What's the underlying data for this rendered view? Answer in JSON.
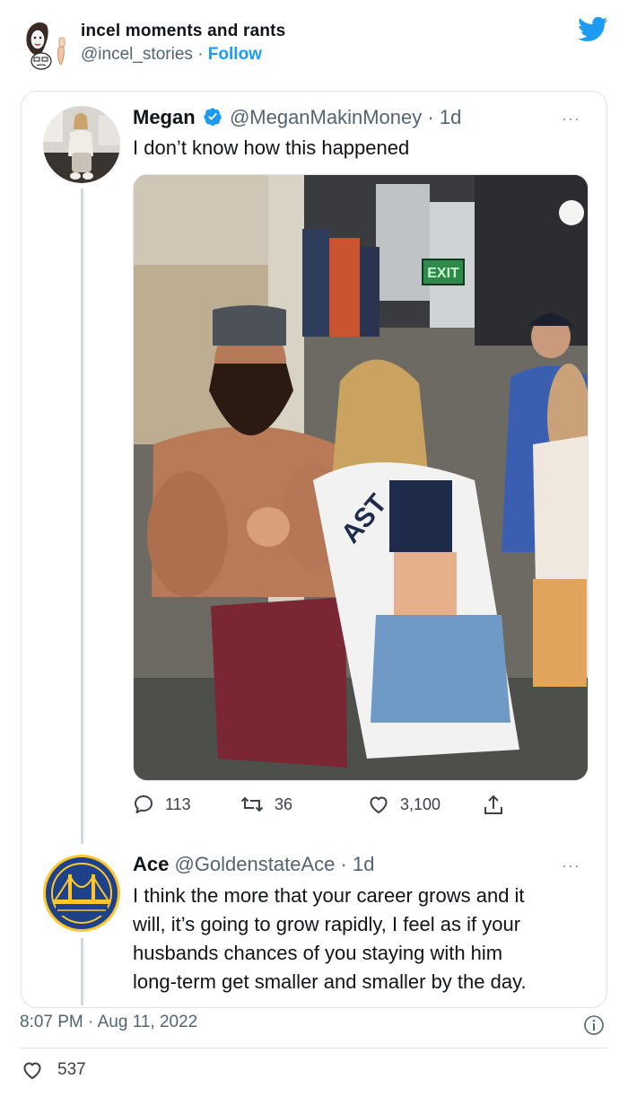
{
  "author": {
    "name": "incel moments and rants",
    "handle": "@incel_stories",
    "separator": "·",
    "follow_label": "Follow"
  },
  "colors": {
    "accent": "#1d9bf0",
    "secondary_text": "#536471",
    "border": "#dfe3e6",
    "warriors_blue": "#1d428a",
    "warriors_gold": "#ffc72c"
  },
  "icons": {
    "brand": "twitter-bird-icon",
    "verified": "verified-badge-icon",
    "reply": "comment-bubble-icon",
    "retweet": "retweet-icon",
    "like": "heart-icon",
    "share": "share-icon",
    "info": "info-icon"
  },
  "tweet1": {
    "name": "Megan",
    "handle": "@MeganMakinMoney",
    "separator": "·",
    "age": "1d",
    "text": "I don’t know how this happened",
    "more": "···",
    "replies": "113",
    "retweets": "36",
    "likes": "3,100"
  },
  "tweet2": {
    "name": "Ace",
    "handle": "@GoldenstateAce",
    "separator": "·",
    "age": "1d",
    "more": "···",
    "text_lines": [
      "I think the more that your career grows and it",
      "will, it’s going to grow rapidly, I feel as if your",
      "husbands chances of you staying with him",
      "long-term get smaller and smaller by the day."
    ]
  },
  "footer": {
    "time": "8:07 PM",
    "separator": "·",
    "date": "Aug 11, 2022",
    "like_count": "537"
  },
  "photo": {
    "exit_sign": "EXIT",
    "jersey_text": "AST"
  }
}
